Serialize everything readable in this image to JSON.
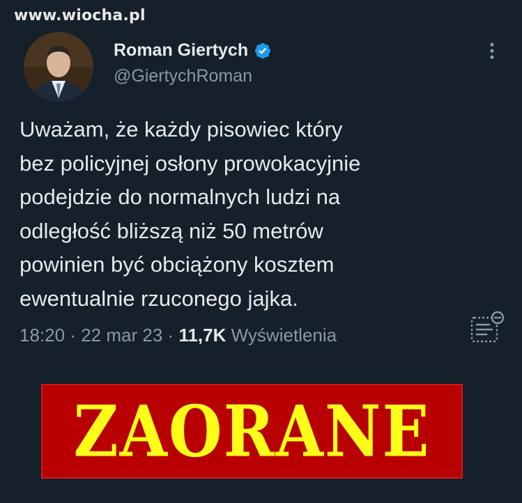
{
  "watermark": "www.wiocha.pl",
  "author": {
    "name": "Roman Giertych",
    "handle": "@GiertychRoman",
    "verified": true
  },
  "tweet": {
    "lines": [
      "Uważam, że każdy pisowiec który",
      "bez policyjnej osłony prowokacyjnie",
      "podejdzie do normalnych ludzi na",
      "odległość bliższą niż 50 metrów",
      "powinien być obciążony kosztem",
      "ewentualnie rzuconego jajka."
    ],
    "time": "18:20",
    "separator": "·",
    "date": "22 mar 23",
    "views_count": "11,7K",
    "views_label": "Wyświetlenia"
  },
  "banner": {
    "text": "ZAORANE"
  },
  "colors": {
    "background": "#15202b",
    "text": "#e7e9ea",
    "secondary": "#8b98a5",
    "verified": "#1d9bf0",
    "banner_bg": "#b80000",
    "banner_text": "#ffff1a"
  },
  "icons": {
    "more": "more-vertical-icon",
    "analytics": "analytics-icon",
    "verified": "verified-badge-icon"
  }
}
